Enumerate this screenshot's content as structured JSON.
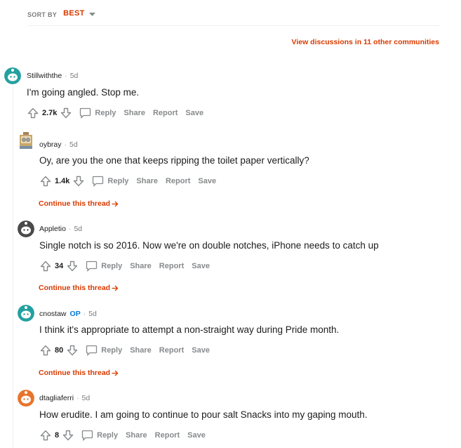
{
  "sort": {
    "label": "SORT BY",
    "value": "BEST"
  },
  "view_discussions": "View discussions in 11 other communities",
  "actions": {
    "reply": "Reply",
    "share": "Share",
    "report": "Report",
    "save": "Save"
  },
  "continue_label": "Continue this thread",
  "comments": [
    {
      "author": "Stillwiththe",
      "time": "5d",
      "text": "I'm going angled. Stop me.",
      "score": "2.7k"
    },
    {
      "author": "oybray",
      "time": "5d",
      "text": "Oy, are you the one that keeps ripping the toilet paper vertically?",
      "score": "1.4k"
    },
    {
      "author": "Appletio",
      "time": "5d",
      "text": "Single notch is so 2016. Now we're on double notches, iPhone needs to catch up",
      "score": "34"
    },
    {
      "author": "cnostaw",
      "op": "OP",
      "time": "5d",
      "text": "I think it's appropriate to attempt a non-straight way during Pride month.",
      "score": "80"
    },
    {
      "author": "dtagliaferri",
      "time": "5d",
      "text": "How erudite. I am going to continue to pour salt Snacks into my gaping mouth.",
      "score": "8"
    }
  ],
  "colors": {
    "accent": "#d93a00",
    "op": "#0079d3",
    "muted": "#878a8c",
    "avatar_teal": "#24a0a0",
    "avatar_orange": "#e8742b"
  }
}
